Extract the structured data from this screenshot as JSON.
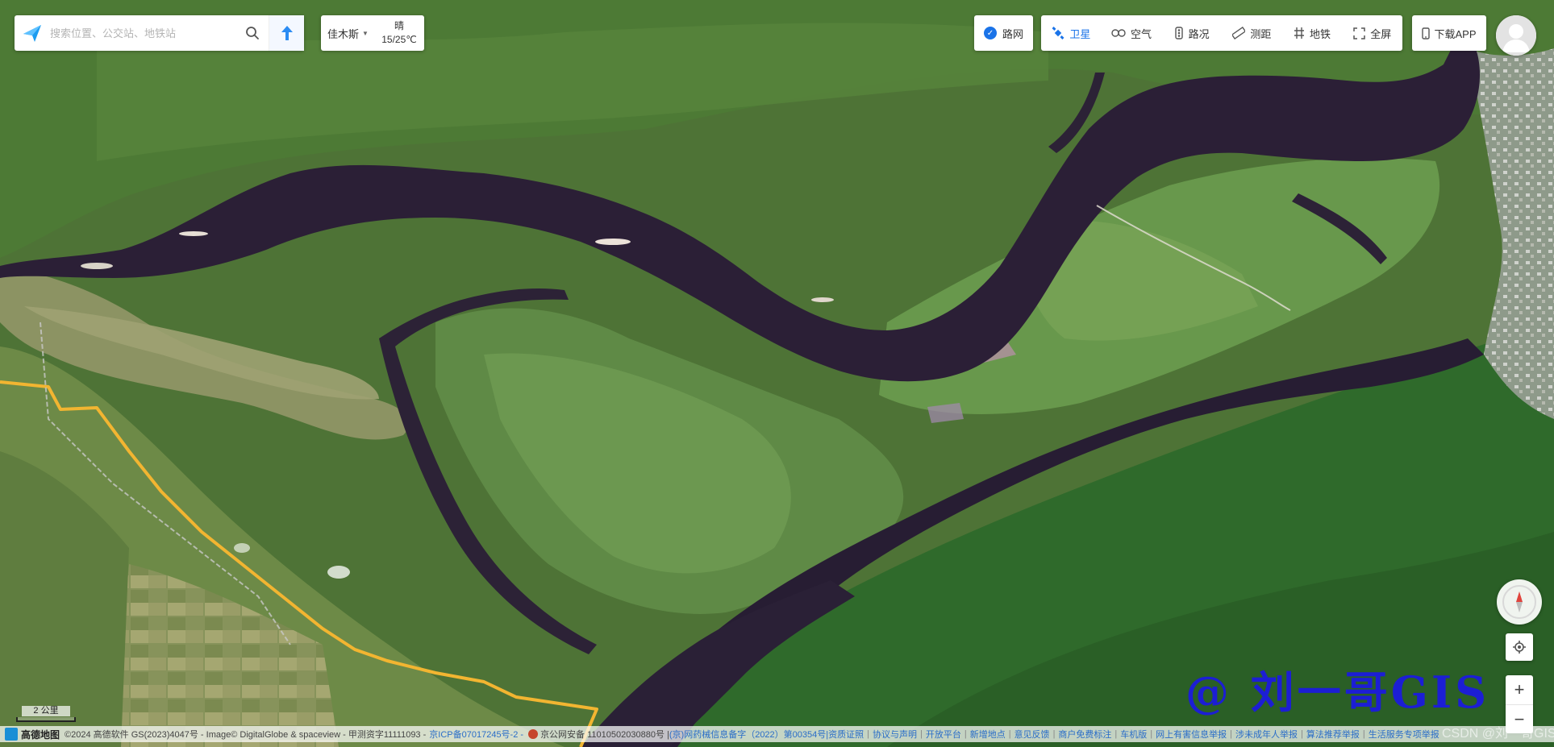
{
  "search": {
    "placeholder": "搜索位置、公交站、地铁站"
  },
  "weather": {
    "city": "佳木斯",
    "condition": "晴",
    "temperature": "15/25℃"
  },
  "toolbar": {
    "road_label": "路网",
    "road_checked": true,
    "layers": [
      {
        "label": "卫星",
        "icon": "satellite-icon",
        "active": true
      },
      {
        "label": "空气",
        "icon": "air-icon",
        "active": false
      },
      {
        "label": "路况",
        "icon": "traffic-light-icon",
        "active": false
      },
      {
        "label": "测距",
        "icon": "ruler-icon",
        "active": false
      },
      {
        "label": "地铁",
        "icon": "subway-icon",
        "active": false
      },
      {
        "label": "全屏",
        "icon": "fullscreen-icon",
        "active": false
      }
    ],
    "download_label": "下载APP"
  },
  "map": {
    "scale_label": "2 公里",
    "watermark": "@ 刘一哥GIS",
    "csdn_mark": "CSDN @刘一哥GIS"
  },
  "footer": {
    "brand": "高德地图",
    "copyright": "©2024 高德软件 GS(2023)4047号 - Image© DigitalGlobe & spaceview - 甲测资字11111093 -",
    "icp": "京ICP备07017245号-2 -",
    "police": "京公网安备 11010502030880号 |",
    "links": [
      "(京)网药械信息备字（2022）第00354号|资质证照",
      "协议与声明",
      "开放平台",
      "新增地点",
      "意见反馈",
      "商户免费标注",
      "车机版",
      "网上有害信息举报",
      "涉未成年人举报",
      "算法推荐举报",
      "生活服务专项举报"
    ]
  },
  "colors": {
    "accent": "#1a73e8",
    "watermark": "#1c1ed4",
    "route": "#f2b531"
  }
}
